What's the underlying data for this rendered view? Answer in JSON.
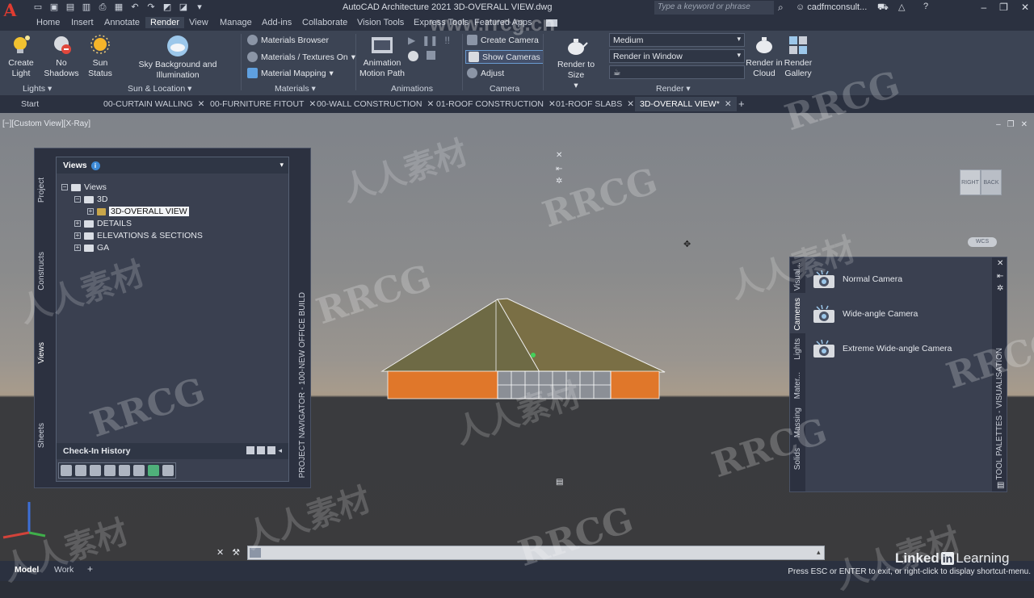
{
  "titlebar": {
    "app_logo": "A",
    "title": "AutoCAD Architecture 2021   3D-OVERALL VIEW.dwg",
    "search_placeholder": "Type a keyword or phrase",
    "user": "cadfmconsult..."
  },
  "menu_tabs": [
    "Home",
    "Insert",
    "Annotate",
    "Render",
    "View",
    "Manage",
    "Add-ins",
    "Collaborate",
    "Vision Tools",
    "Express Tools",
    "Featured Apps"
  ],
  "active_menu_tab": "Render",
  "ribbon": {
    "lights": {
      "create_light": "Create Light",
      "no_shadows": "No Shadows",
      "panel_label": "Lights"
    },
    "sun_location": {
      "sun_status": "Sun Status",
      "sky_background": "Sky Background and Illumination",
      "panel_label": "Sun & Location"
    },
    "materials": {
      "materials_browser": "Materials Browser",
      "materials_textures": "Materials / Textures On",
      "material_mapping": "Material Mapping",
      "panel_label": "Materials"
    },
    "animations": {
      "animation_motion_path": "Animation Motion Path",
      "panel_label": "Animations"
    },
    "camera": {
      "create_camera": "Create Camera",
      "show_cameras": "Show  Cameras",
      "adjust": "Adjust",
      "panel_label": "Camera"
    },
    "render": {
      "render_to_size": "Render to Size",
      "quality_select": "Medium",
      "render_target_select": "Render in Window",
      "render_in_cloud": "Render in Cloud",
      "render_gallery": "Render Gallery",
      "panel_label": "Render"
    }
  },
  "doc_tabs": [
    {
      "label": "Start",
      "closable": false
    },
    {
      "label": "00-CURTAIN WALLING",
      "closable": true
    },
    {
      "label": "00-FURNITURE FITOUT",
      "closable": true
    },
    {
      "label": "00-WALL CONSTRUCTION",
      "closable": true
    },
    {
      "label": "01-ROOF CONSTRUCTION",
      "closable": true
    },
    {
      "label": "01-ROOF SLABS",
      "closable": true
    },
    {
      "label": "3D-OVERALL VIEW*",
      "closable": true
    }
  ],
  "active_doc_tab": "3D-OVERALL VIEW*",
  "viewport": {
    "label": "[−][Custom View][X-Ray]",
    "viewcube_right": "RIGHT",
    "viewcube_back": "BACK",
    "wcs": "WCS"
  },
  "project_navigator": {
    "title": "PROJECT NAVIGATOR - 100-NEW OFFICE BUILD",
    "side_tabs": [
      "Project",
      "Constructs",
      "Views",
      "Sheets"
    ],
    "active_side_tab": "Views",
    "views_header": "Views",
    "views_badge": "i",
    "tree": [
      {
        "label": "Views",
        "level": 0,
        "expanded": true
      },
      {
        "label": "3D",
        "level": 1,
        "expanded": true
      },
      {
        "label": "3D-OVERALL VIEW",
        "level": 2,
        "selected": true
      },
      {
        "label": "DETAILS",
        "level": 1,
        "expanded": false
      },
      {
        "label": "ELEVATIONS & SECTIONS",
        "level": 1,
        "expanded": false
      },
      {
        "label": "GA",
        "level": 1,
        "expanded": false
      }
    ],
    "checkin_history": "Check-In History"
  },
  "tool_palettes": {
    "title": "TOOL PALETTES - VISUALISATION",
    "side_tabs": [
      "Visual...",
      "Cameras",
      "Lights",
      "Mater...",
      "Massing",
      "Solids"
    ],
    "active_side_tab": "Cameras",
    "items": [
      "Normal Camera",
      "Wide-angle Camera",
      "Extreme Wide-angle Camera"
    ]
  },
  "status": {
    "tabs": [
      "Model",
      "Work"
    ],
    "active_tab": "Model",
    "prompt": "Press ESC or ENTER to exit, or right-click to display shortcut-menu."
  },
  "branding": {
    "linked": "Linked",
    "in": "in",
    "learning": " Learning"
  },
  "watermarks": {
    "rrcg": "RRCG",
    "chinese": "人人素材",
    "url": "www.rrcg.cn"
  },
  "colors": {
    "ribbon_bg": "#3c4454",
    "titlebar_bg": "#2b3140",
    "accent_blue": "#3d89d6",
    "app_red": "#e03c31"
  }
}
